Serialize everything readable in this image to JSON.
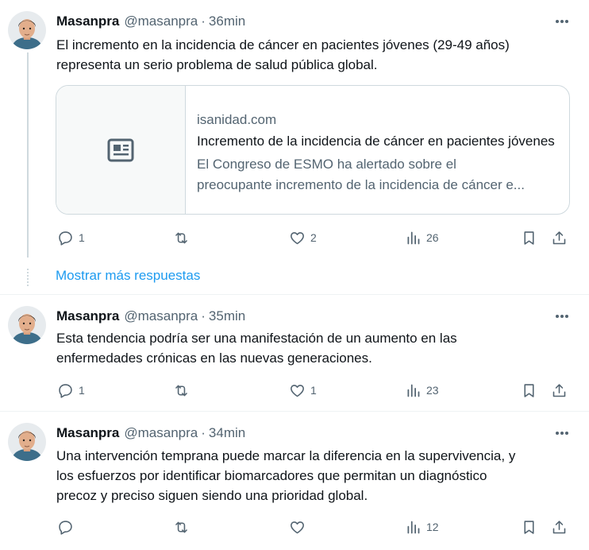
{
  "tweets": [
    {
      "name": "Masanpra",
      "handle": "@masanpra",
      "dot": "·",
      "time": "36min",
      "lines": [
        "El incremento en la incidencia de cáncer en pacientes jóvenes (29-49 años)",
        "representa un serio problema de salud pública global."
      ],
      "card": {
        "domain": "isanidad.com",
        "title": "Incremento de la incidencia de cáncer en pacientes jóvenes",
        "desc_lines": [
          "El Congreso de ESMO ha alertado sobre el",
          "preocupante incremento de la incidencia de cáncer e..."
        ]
      },
      "replies": "1",
      "retweets": "",
      "likes": "2",
      "views": "26"
    },
    {
      "name": "Masanpra",
      "handle": "@masanpra",
      "dot": "·",
      "time": "35min",
      "lines": [
        "Esta tendencia podría ser una manifestación de un aumento en las",
        "enfermedades crónicas en las nuevas generaciones."
      ],
      "replies": "1",
      "retweets": "",
      "likes": "1",
      "views": "23"
    },
    {
      "name": "Masanpra",
      "handle": "@masanpra",
      "dot": "·",
      "time": "34min",
      "lines": [
        "Una intervención temprana puede marcar la diferencia en la supervivencia, y",
        "los esfuerzos por identificar biomarcadores que permitan un diagnóstico",
        "precoz y preciso siguen siendo una prioridad global."
      ],
      "replies": "",
      "retweets": "",
      "likes": "",
      "views": "12"
    }
  ],
  "show_more_label": "Mostrar más respuestas",
  "icons": {
    "reply": "reply-icon",
    "retweet": "retweet-icon",
    "like": "like-icon",
    "views": "views-icon",
    "bookmark": "bookmark-icon",
    "share": "share-icon",
    "more": "more-icon",
    "article": "article-icon"
  },
  "colors": {
    "text": "#0f1419",
    "secondary": "#536471",
    "link": "#1d9bf0",
    "border": "#cfd9de"
  }
}
